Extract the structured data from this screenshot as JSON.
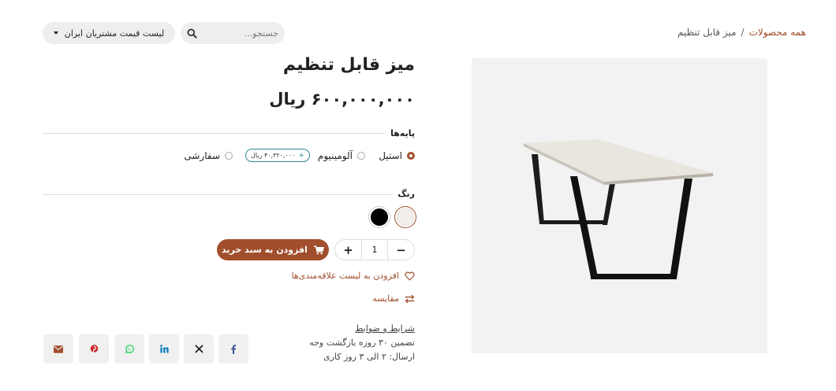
{
  "breadcrumb": {
    "all_products": "همه محصولات",
    "separator": "/",
    "current": "میز قابل تنظیم"
  },
  "search": {
    "placeholder": "جستجو..."
  },
  "pricelist": {
    "label": "لیست قیمت مشتریان ایران"
  },
  "product": {
    "title": "میز قابل تنظیم",
    "price": "۶۰۰,۰۰۰,۰۰۰ ریال"
  },
  "legs": {
    "label": "پایه‌ها",
    "options": [
      {
        "label": "استیل",
        "selected": true
      },
      {
        "label": "آلومینیوم",
        "selected": false,
        "extra_price": "۴۰,۳۲۰,۰۰۰ ریال"
      },
      {
        "label": "سفارشی",
        "selected": false
      }
    ],
    "extra_sign": "+"
  },
  "color": {
    "label": "رنگ",
    "swatches": [
      {
        "name": "white",
        "hex": "#f2efeb",
        "selected": true
      },
      {
        "name": "black",
        "hex": "#000000",
        "selected": false
      }
    ]
  },
  "quantity": {
    "value": "1",
    "minus": "−",
    "plus": "+"
  },
  "actions": {
    "add_to_cart": "افزودن به سبد خرید",
    "wishlist": "افزودن به لیست علاقه‌مندی‌ها",
    "compare": "مقایسه"
  },
  "info": {
    "terms": "شرایط و ضوابط",
    "guarantee": "تضمین ۳۰ روزه بازگشت وجه",
    "shipping": "ارسال: ۲ الی ۳ روز کاری"
  },
  "share": [
    "facebook-icon",
    "x-icon",
    "linkedin-icon",
    "whatsapp-icon",
    "pinterest-icon",
    "email-icon"
  ],
  "colors": {
    "accent": "#a14e2c",
    "teal": "#2a8a94",
    "facebook": "#3b5998",
    "linkedin": "#0077b5",
    "whatsapp": "#25d366",
    "pinterest": "#cb2027"
  }
}
